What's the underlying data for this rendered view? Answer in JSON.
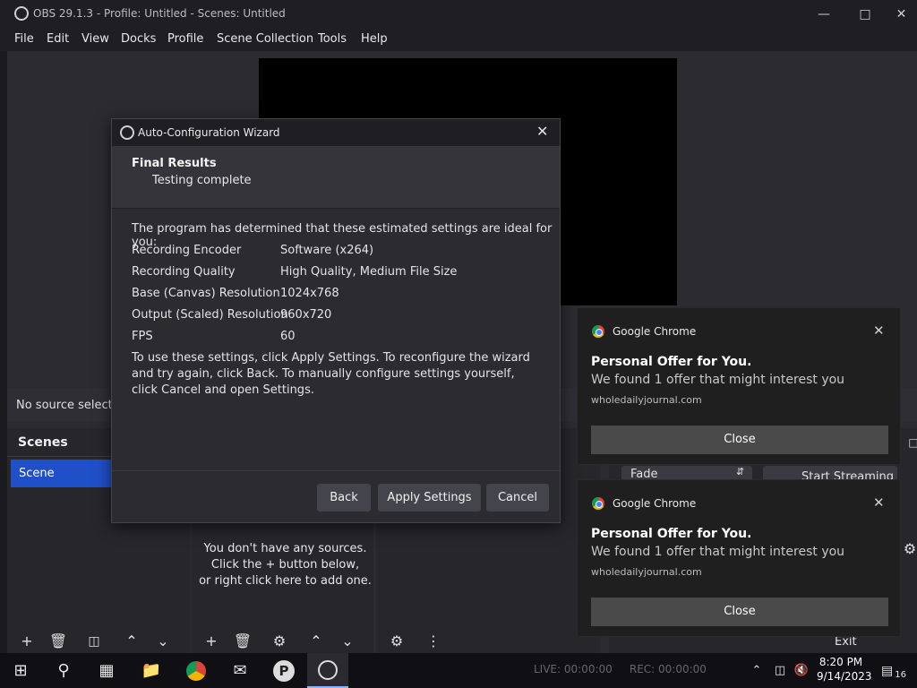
{
  "window": {
    "title": "OBS 29.1.3 - Profile: Untitled - Scenes: Untitled",
    "min_icon": "minimize-icon",
    "max_icon": "maximize-icon",
    "close_icon": "close-icon"
  },
  "menu": [
    "File",
    "Edit",
    "View",
    "Docks",
    "Profile",
    "Scene Collection",
    "Tools",
    "Help"
  ],
  "main": {
    "no_source": "No source selected",
    "scenes_header": "Scenes",
    "scene_item": "Scene",
    "sources_empty": [
      "You don't have any sources.",
      "Click the + button below,",
      "or right click here to add one."
    ],
    "transition": "Fade",
    "start_streaming": "Start Streaming",
    "exit": "Exit",
    "live": "LIVE: 00:00:00",
    "rec": "REC: 00:00:00"
  },
  "dialog": {
    "title": "Auto-Configuration Wizard",
    "header_title": "Final Results",
    "header_sub": "Testing complete",
    "intro": "The program has determined that these estimated settings are ideal for you:",
    "settings": [
      {
        "label": "Recording Encoder",
        "value": "Software (x264)"
      },
      {
        "label": "Recording Quality",
        "value": "High Quality, Medium File Size"
      },
      {
        "label": "Base (Canvas) Resolution",
        "value": "1024x768"
      },
      {
        "label": "Output (Scaled) Resolution",
        "value": "960x720"
      },
      {
        "label": "FPS",
        "value": "60"
      }
    ],
    "description": "To use these settings, click Apply Settings. To reconfigure the wizard and try again, click Back. To manually configure settings yourself, click Cancel and open Settings.",
    "btn_back": "Back",
    "btn_apply": "Apply Settings",
    "btn_cancel": "Cancel"
  },
  "notifications": [
    {
      "app": "Google Chrome",
      "title": "Personal Offer for You.",
      "message": "We found 1 offer that might interest you",
      "source": "wholedailyjournal.com",
      "button": "Close"
    },
    {
      "app": "Google Chrome",
      "title": "Personal Offer for You.",
      "message": "We found 1 offer that might interest you",
      "source": "wholedailyjournal.com",
      "button": "Close"
    }
  ],
  "taskbar": {
    "time": "8:20 PM",
    "date": "9/14/2023",
    "notification_count": "16"
  }
}
